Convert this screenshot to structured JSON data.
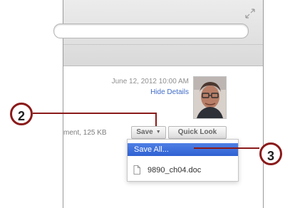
{
  "message": {
    "date": "June 12, 2012  10:00 AM",
    "hide_details": "Hide Details",
    "attachment_info": "ment, 125 KB"
  },
  "buttons": {
    "save": "Save",
    "quick_look": "Quick Look"
  },
  "menu": {
    "items": [
      {
        "label": "Save All..."
      },
      {
        "label": "9890_ch04.doc"
      }
    ]
  },
  "callouts": {
    "first": "2",
    "second": "3"
  },
  "colors": {
    "callout": "#8b1a1a",
    "menu_highlight": "#2f61d2",
    "link": "#3f6bc7"
  },
  "icons": {
    "fullscreen": "fullscreen-icon",
    "save_arrow": "chevron-down-icon",
    "file": "document-icon"
  }
}
